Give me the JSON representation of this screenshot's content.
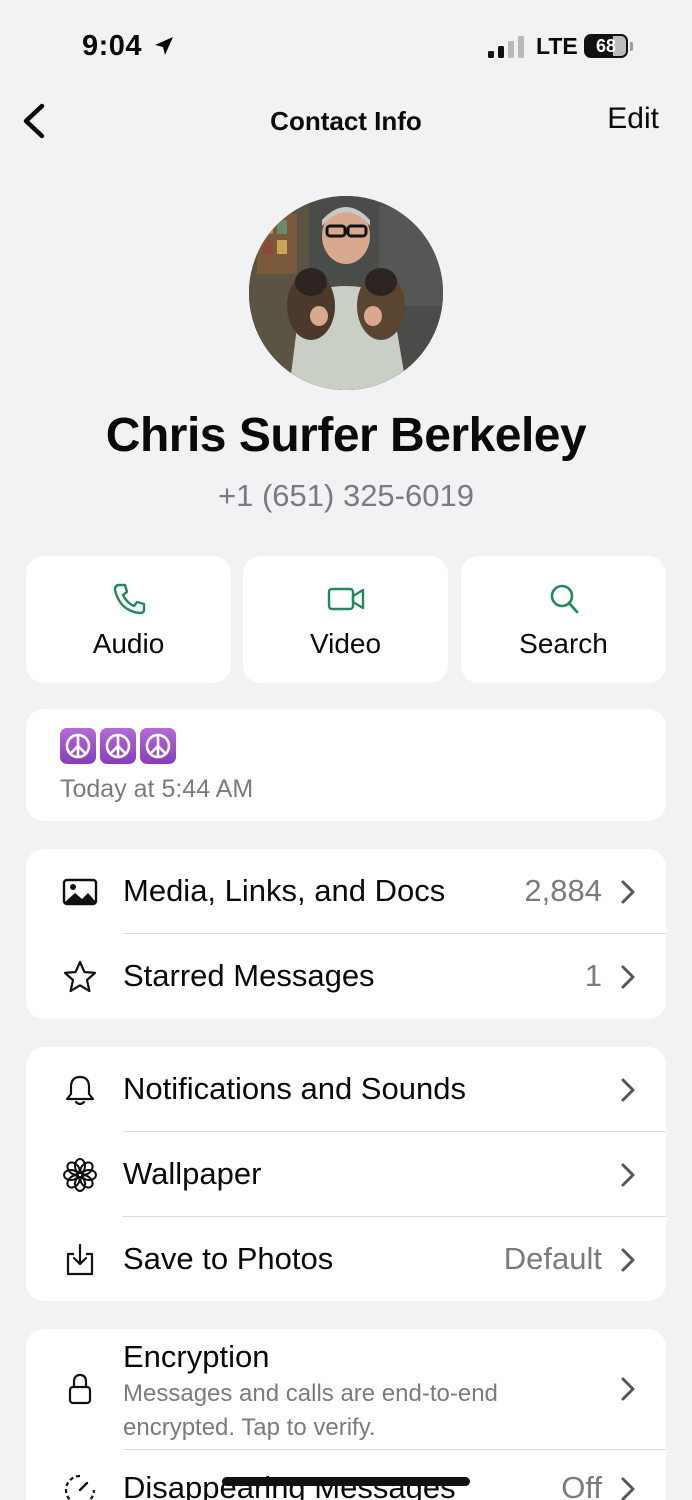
{
  "status_bar": {
    "time": "9:04",
    "network": "LTE",
    "battery": "68",
    "battery_fraction": 0.68
  },
  "nav": {
    "title": "Contact Info",
    "edit_label": "Edit",
    "back_icon": "chevron-left-icon"
  },
  "contact": {
    "name": "Chris Surfer Berkeley",
    "phone": "+1 (651) 325-6019"
  },
  "actions": [
    {
      "label": "Audio",
      "icon": "phone-icon"
    },
    {
      "label": "Video",
      "icon": "video-camera-icon"
    },
    {
      "label": "Search",
      "icon": "search-icon"
    }
  ],
  "about": {
    "emoji": "☮☮☮",
    "timestamp": "Today at 5:44 AM"
  },
  "media_group": [
    {
      "label": "Media, Links, and Docs",
      "value": "2,884",
      "icon": "photo-icon"
    },
    {
      "label": "Starred Messages",
      "value": "1",
      "icon": "star-icon"
    }
  ],
  "settings_group": [
    {
      "label": "Notifications and Sounds",
      "value": "",
      "icon": "bell-icon"
    },
    {
      "label": "Wallpaper",
      "value": "",
      "icon": "flower-icon"
    },
    {
      "label": "Save to Photos",
      "value": "Default",
      "icon": "save-download-icon"
    }
  ],
  "privacy_group": {
    "encryption": {
      "label": "Encryption",
      "subtitle": "Messages and calls are end-to-end encrypted. Tap to verify.",
      "icon": "lock-icon"
    },
    "disappearing": {
      "label": "Disappearing Messages",
      "value": "Off",
      "icon": "timer-icon"
    }
  },
  "colors": {
    "accent": "#1f8a5a",
    "background": "#f2f2f4",
    "card": "#ffffff",
    "secondary_text": "#7b7b7f"
  }
}
